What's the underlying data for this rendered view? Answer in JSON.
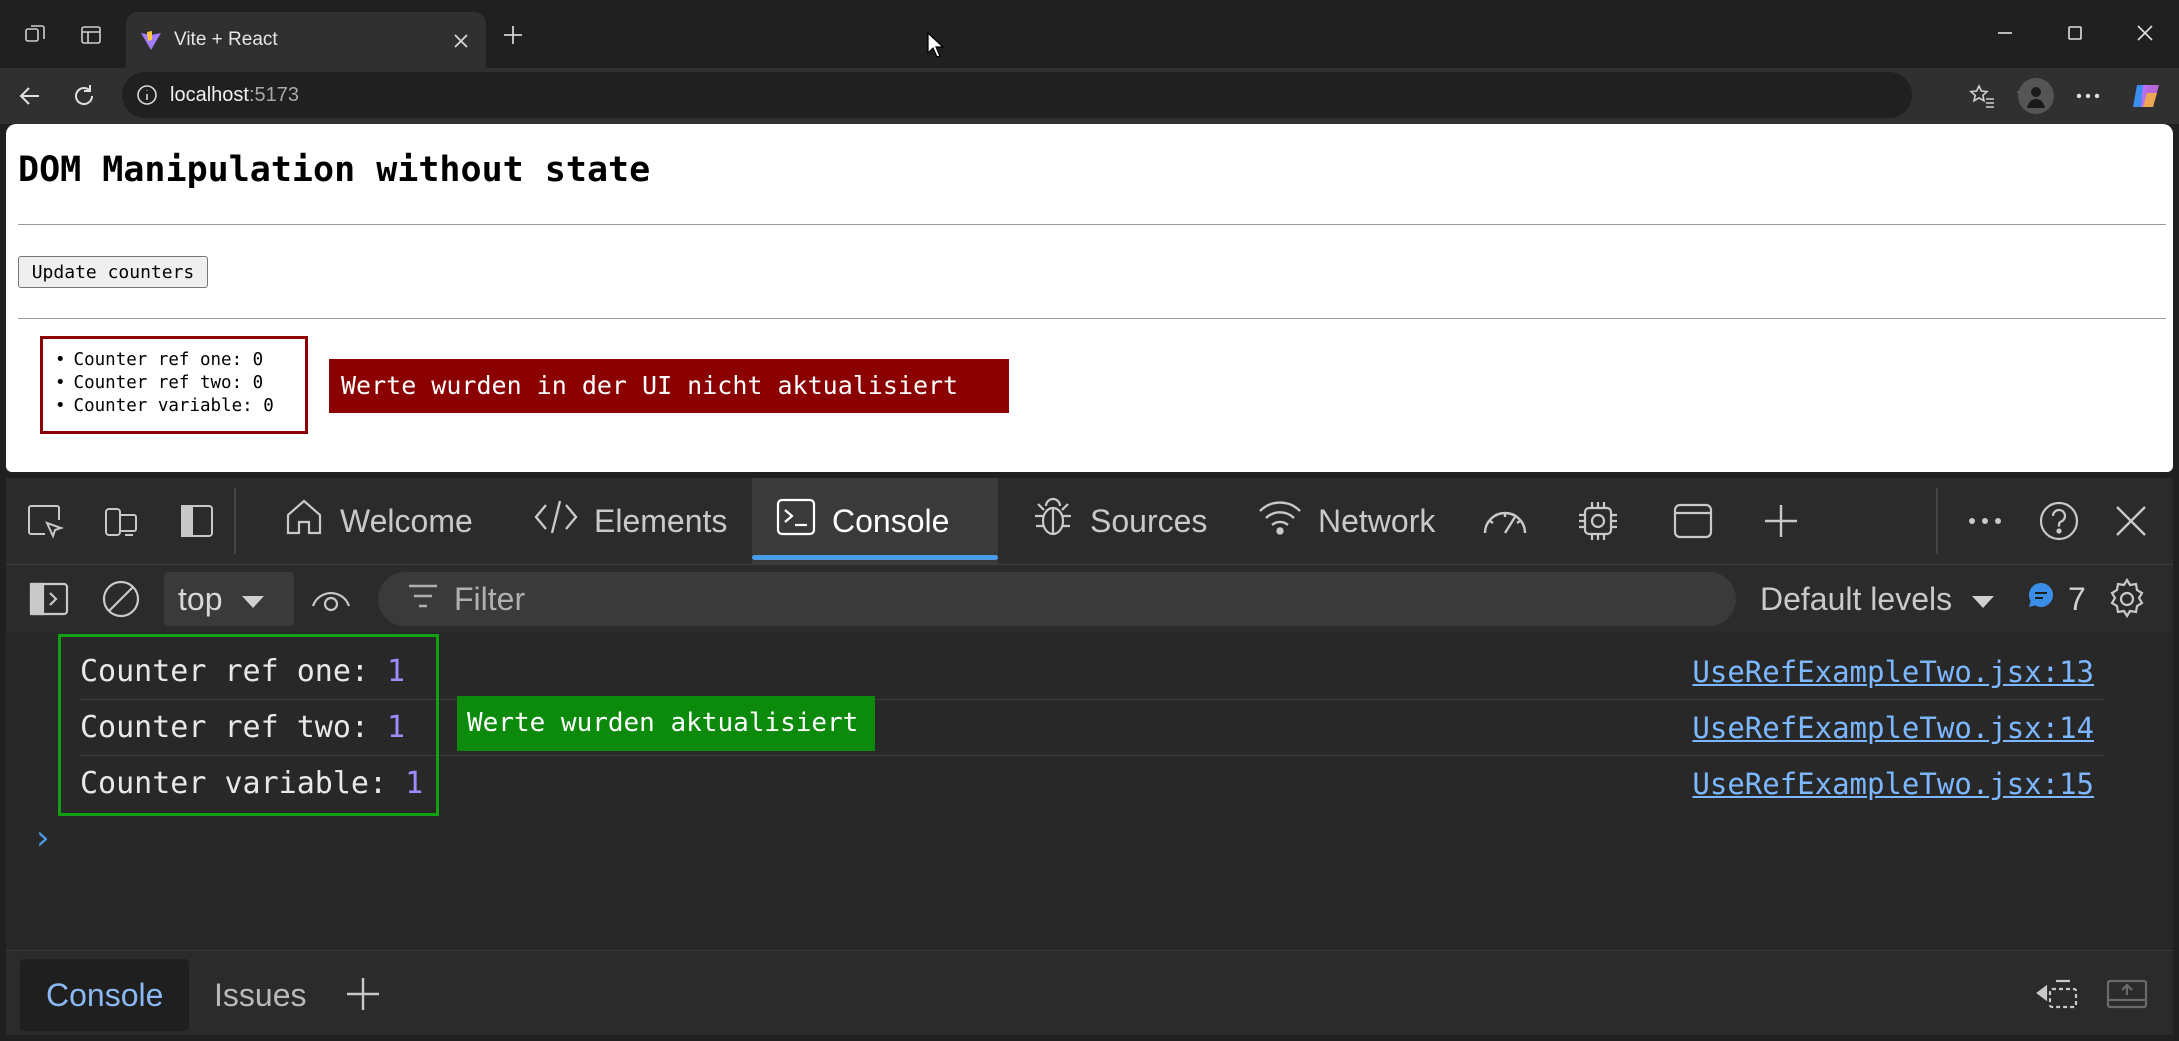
{
  "browser": {
    "tab_title": "Vite + React",
    "url_host": "localhost",
    "url_port": ":5173"
  },
  "page": {
    "heading": "DOM Manipulation without state",
    "update_button": "Update counters",
    "counters": [
      "Counter ref one: 0",
      "Counter ref two: 0",
      "Counter variable: 0"
    ],
    "red_note": "Werte wurden in der UI nicht aktualisiert"
  },
  "devtools": {
    "tabs": [
      {
        "label": "Welcome",
        "icon": "home-icon"
      },
      {
        "label": "Elements",
        "icon": "code-icon"
      },
      {
        "label": "Console",
        "icon": "terminal-icon"
      },
      {
        "label": "Sources",
        "icon": "bug-icon"
      },
      {
        "label": "Network",
        "icon": "wifi-icon"
      }
    ],
    "context": "top",
    "filter_placeholder": "Filter",
    "levels": "Default levels",
    "message_count": "7",
    "logs": [
      {
        "label": "Counter ref one: ",
        "value": "1",
        "source": "UseRefExampleTwo.jsx:13"
      },
      {
        "label": "Counter ref two: ",
        "value": "1",
        "source": "UseRefExampleTwo.jsx:14"
      },
      {
        "label": "Counter variable: ",
        "value": "1",
        "source": "UseRefExampleTwo.jsx:15"
      }
    ],
    "green_note": "Werte wurden aktualisiert",
    "drawer_tabs": [
      "Console",
      "Issues"
    ]
  },
  "colors": {
    "red_note": "#8b0000",
    "green_note": "#0b8a0b",
    "accent": "#4a9ce8"
  }
}
